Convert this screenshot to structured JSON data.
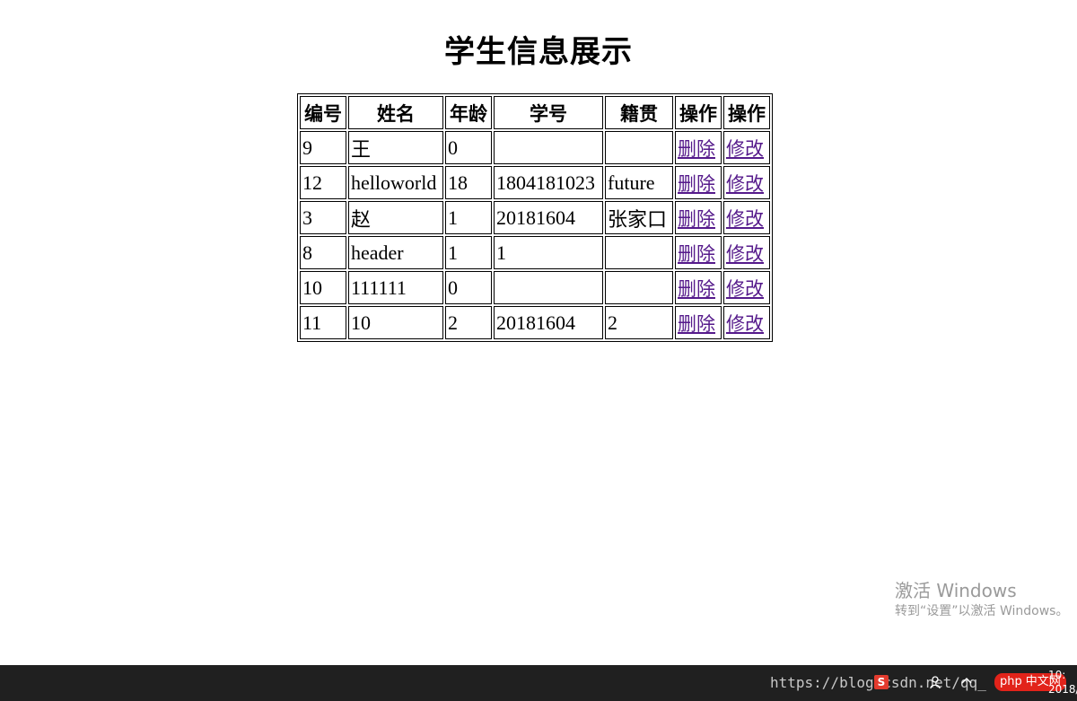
{
  "page": {
    "title": "学生信息展示"
  },
  "table": {
    "headers": [
      "编号",
      "姓名",
      "年龄",
      "学号",
      "籍贯",
      "操作",
      "操作"
    ],
    "rows": [
      {
        "id": "9",
        "name": "王",
        "age": "0",
        "student_no": "",
        "hometown": "",
        "delete": "删除",
        "edit": "修改"
      },
      {
        "id": "12",
        "name": "helloworld",
        "age": "18",
        "student_no": "1804181023",
        "hometown": "future",
        "delete": "删除",
        "edit": "修改"
      },
      {
        "id": "3",
        "name": "赵",
        "age": "1",
        "student_no": "20181604",
        "hometown": "张家口",
        "delete": "删除",
        "edit": "修改"
      },
      {
        "id": "8",
        "name": "header",
        "age": "1",
        "student_no": "1",
        "hometown": "",
        "delete": "删除",
        "edit": "修改"
      },
      {
        "id": "10",
        "name": "111111",
        "age": "0",
        "student_no": "",
        "hometown": "",
        "delete": "删除",
        "edit": "修改"
      },
      {
        "id": "11",
        "name": "10",
        "age": "2",
        "student_no": "20181604",
        "hometown": "2",
        "delete": "删除",
        "edit": "修改"
      }
    ]
  },
  "watermark": {
    "line1": "激活 Windows",
    "line2": "转到“设置”以激活 Windows。"
  },
  "taskbar": {
    "url_overlay": "https://blog.csdn.net/qq_",
    "s_icon": "S",
    "php_badge": "php",
    "php_suffix": "中文网",
    "clock_time": "10:",
    "clock_date": "2018/"
  },
  "colors": {
    "link_visited": "#551a8b",
    "taskbar_bg": "#202020",
    "watermark_text": "#9a9a9a"
  }
}
